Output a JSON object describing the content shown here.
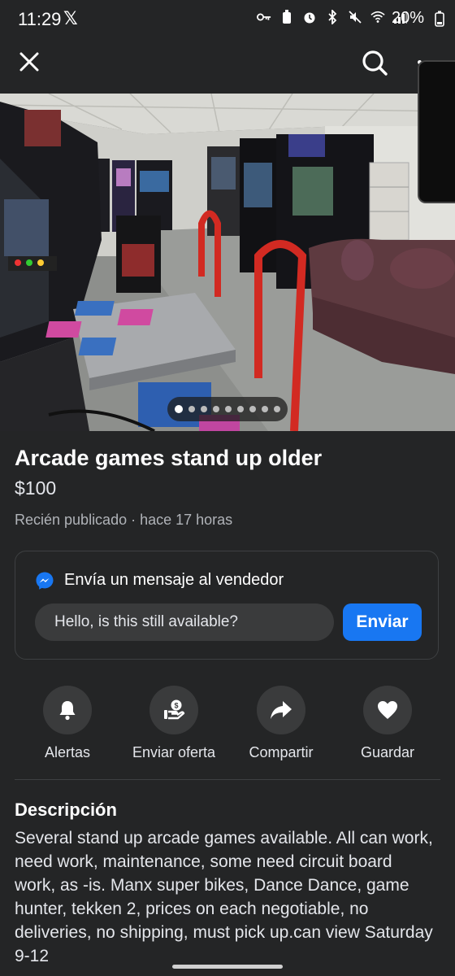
{
  "status_bar": {
    "time": "11:29",
    "x_app": "𝕏",
    "battery": "20%"
  },
  "photo": {
    "description_icon": "listing-photo",
    "page_count": 9,
    "active_index": 0
  },
  "listing": {
    "title": "Arcade games stand up older",
    "price": "$100",
    "posted": "Recién publicado · hace 17 horas"
  },
  "message": {
    "heading": "Envía un mensaje al vendedor",
    "input_value": "Hello, is this still available?",
    "send_label": "Enviar"
  },
  "actions": [
    {
      "label": "Alertas",
      "icon": "bell-icon"
    },
    {
      "label": "Enviar oferta",
      "icon": "offer-icon"
    },
    {
      "label": "Compartir",
      "icon": "share-icon"
    },
    {
      "label": "Guardar",
      "icon": "heart-icon"
    }
  ],
  "description": {
    "heading": "Descripción",
    "body": "Several stand up arcade games available. All can work, need work, maintenance, some need circuit board work, as -is. Manx super bikes, Dance Dance, game hunter, tekken 2, prices on each negotiable, no deliveries, no shipping, must pick up.can view Saturday 9-12"
  },
  "colors": {
    "background": "#242526",
    "accent": "#1877f2"
  }
}
